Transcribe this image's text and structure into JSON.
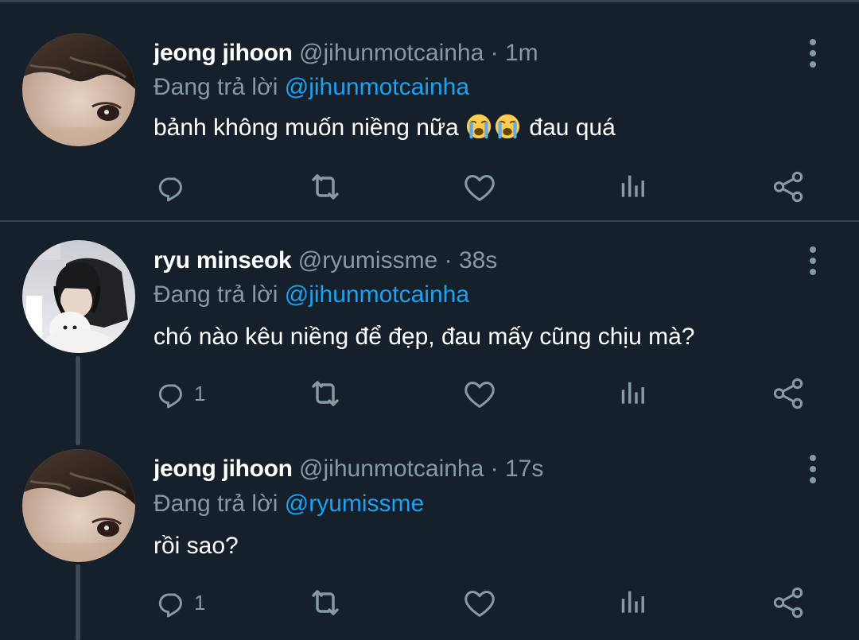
{
  "colors": {
    "background": "#15202b",
    "divider": "#38444d",
    "secondary_text": "#8899a6",
    "mention": "#1da1f2",
    "primary_text": "#ffffff"
  },
  "tweets": [
    {
      "name": "jeong jihoon",
      "handle": "@jihunmotcainha",
      "separator": "·",
      "time": "1m",
      "replying_prefix": "Đang trả lời ",
      "replying_to": "@jihunmotcainha",
      "text_before": "bảnh không muốn niềng nữa ",
      "emoji": "loudly-crying-face",
      "emoji_count": 2,
      "text_after": " đau quá",
      "reply_count": "",
      "avatar": "avatar-jihoon"
    },
    {
      "name": "ryu minseok",
      "handle": "@ryumissme",
      "separator": "·",
      "time": "38s",
      "replying_prefix": "Đang trả lời ",
      "replying_to": "@jihunmotcainha",
      "text": "chó nào kêu niềng để đẹp, đau mấy cũng chịu mà?",
      "reply_count": "1",
      "avatar": "avatar-minseok"
    },
    {
      "name": "jeong jihoon",
      "handle": "@jihunmotcainha",
      "separator": "·",
      "time": "17s",
      "replying_prefix": "Đang trả lời ",
      "replying_to": "@ryumissme",
      "text": "rồi sao?",
      "reply_count": "1",
      "avatar": "avatar-jihoon"
    }
  ],
  "icons": [
    "reply-icon",
    "retweet-icon",
    "like-icon",
    "analytics-icon",
    "share-icon",
    "more-options-icon"
  ]
}
